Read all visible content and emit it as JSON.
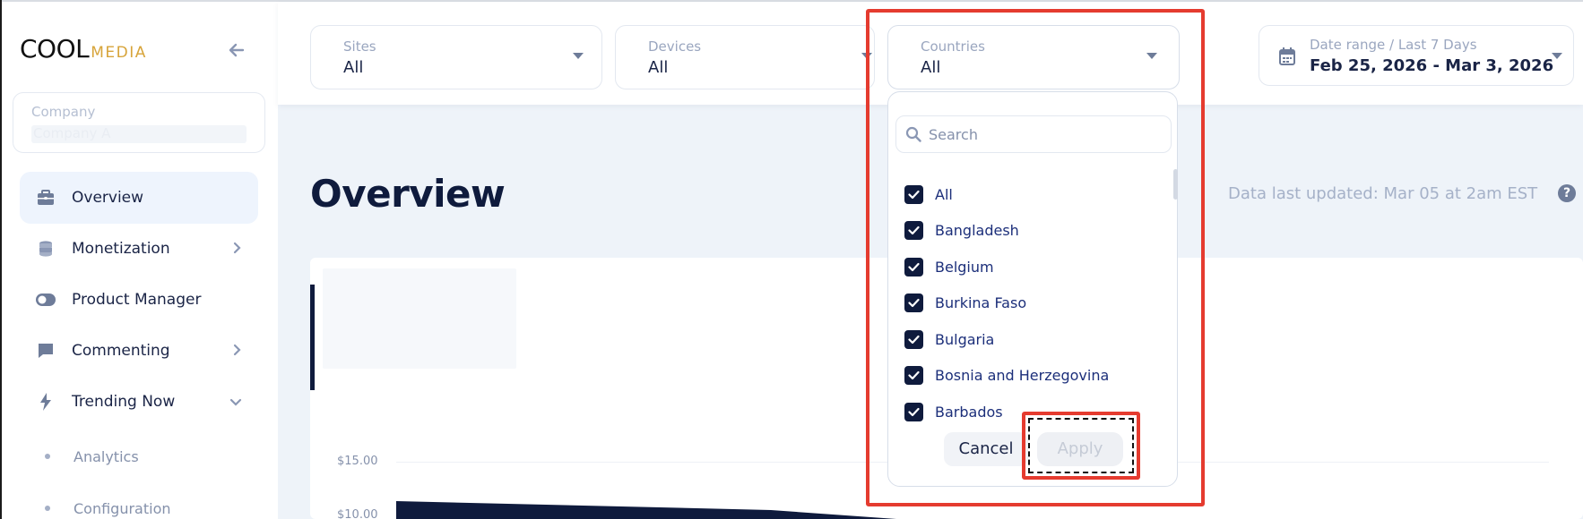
{
  "brand": {
    "logo_part1": "COOL",
    "logo_part2": "MEDIA",
    "accent_color": "#d7a43a"
  },
  "sidebar": {
    "company_label": "Company",
    "company_value": "Company A",
    "items": [
      {
        "label": "Overview",
        "icon": "briefcase-icon",
        "active": true
      },
      {
        "label": "Monetization",
        "icon": "coins-icon",
        "chevron": "right"
      },
      {
        "label": "Product Manager",
        "icon": "toggle-icon"
      },
      {
        "label": "Commenting",
        "icon": "comment-icon",
        "chevron": "right"
      },
      {
        "label": "Trending Now",
        "icon": "bolt-icon",
        "chevron": "down"
      }
    ],
    "sub_items": [
      {
        "label": "Analytics"
      },
      {
        "label": "Configuration"
      }
    ]
  },
  "filters": {
    "sites": {
      "label": "Sites",
      "value": "All"
    },
    "devices": {
      "label": "Devices",
      "value": "All"
    },
    "countries": {
      "label": "Countries",
      "value": "All"
    },
    "date": {
      "label": "Date range / Last 7 Days",
      "value": "Feb 25, 2026 - Mar 3, 2026"
    }
  },
  "main": {
    "title": "Overview",
    "last_updated": "Data last updated: Mar 05 at 2am EST",
    "help": "?"
  },
  "chart": {
    "y_ticks": [
      "$15.00",
      "$10.00"
    ],
    "series_color": "#0f1b3d"
  },
  "countries_dropdown": {
    "search_placeholder": "Search",
    "options": [
      {
        "label": "All",
        "checked": true
      },
      {
        "label": "Bangladesh",
        "checked": true
      },
      {
        "label": "Belgium",
        "checked": true
      },
      {
        "label": "Burkina Faso",
        "checked": true
      },
      {
        "label": "Bulgaria",
        "checked": true
      },
      {
        "label": "Bosnia and Herzegovina",
        "checked": true
      },
      {
        "label": "Barbados",
        "checked": true
      }
    ],
    "cancel_label": "Cancel",
    "apply_label": "Apply"
  }
}
